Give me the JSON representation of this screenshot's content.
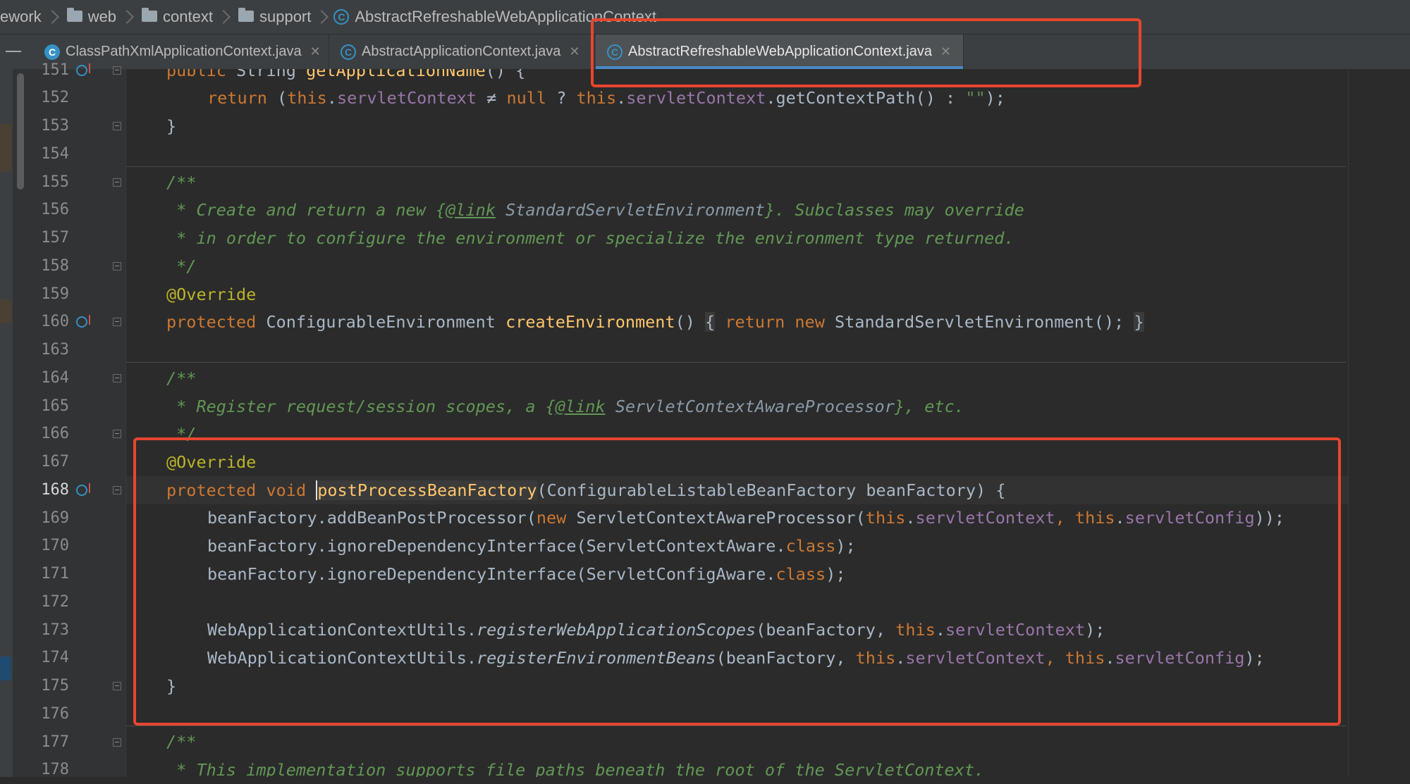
{
  "breadcrumb": {
    "items": [
      "ework",
      "web",
      "context",
      "support"
    ],
    "current": "AbstractRefreshableWebApplicationContext"
  },
  "tabs": [
    {
      "label": "ClassPathXmlApplicationContext.java",
      "icon": "class-icon"
    },
    {
      "label": "AbstractApplicationContext.java",
      "icon": "abstract-class-icon"
    },
    {
      "label": "AbstractRefreshableWebApplicationContext.java",
      "icon": "abstract-class-icon",
      "active": true
    }
  ],
  "editor": {
    "line_numbers": [
      "151",
      "152",
      "153",
      "154",
      "155",
      "156",
      "157",
      "158",
      "159",
      "160",
      "163",
      "164",
      "165",
      "166",
      "167",
      "168",
      "169",
      "170",
      "171",
      "172",
      "173",
      "174",
      "175",
      "176",
      "177",
      "178"
    ],
    "current_line": "168"
  },
  "colors": {
    "background": "#2b2b2b",
    "keyword": "#cc7832",
    "field": "#9876aa",
    "method": "#ffc66d",
    "annotation": "#bbb529",
    "comment": "#629755",
    "annotation_box": "#e8452f"
  },
  "code": {
    "l151": {
      "kw": "public",
      "type": " String ",
      "fn": "getApplicationName",
      "rest": "() {"
    },
    "l152": {
      "kw1": "return",
      "p1": " (",
      "kw2": "this",
      "dot1": ".",
      "f1": "servletContext",
      "p2": " ≠ ",
      "kw3": "null",
      "p3": " ? ",
      "kw4": "this",
      "dot2": ".",
      "f2": "servletContext",
      "p4": ".getContextPath() : ",
      "s": "\"\"",
      "p5": ");"
    },
    "l153": "}",
    "l155": "/**",
    "l156": {
      "a": " * Create and return a new {",
      "tag": "@link",
      "b": " ",
      "ref": "StandardServletEnvironment",
      "c": "}. Subclasses may override"
    },
    "l157": " * in order to configure the environment or specialize the environment type returned.",
    "l158": " */",
    "l159": "@Override",
    "l160": {
      "kw": "protected",
      "type": " ConfigurableEnvironment ",
      "fn": "createEnvironment",
      "p": "() ",
      "fb1": "{",
      "sp": " ",
      "kw2": "return",
      "sp2": " ",
      "kw3": "new",
      "rest": " StandardServletEnvironment();",
      "sp3": " ",
      "fb2": "}"
    },
    "l164": "/**",
    "l165": {
      "a": " * Register request/session scopes, a {",
      "tag": "@link",
      "b": " ",
      "ref": "ServletContextAwareProcessor",
      "c": "}, etc."
    },
    "l166": " */",
    "l167": "@Override",
    "l168": {
      "kw1": "protected",
      "sp": " ",
      "kw2": "void",
      "sp2": " ",
      "fn": "postProcessBeanFactory",
      "rest": "(ConfigurableListableBeanFactory beanFactory) {"
    },
    "l169": {
      "a": "beanFactory.addBeanPostProcessor(",
      "kw": "new",
      "b": " ServletContextAwareProcessor(",
      "kw2": "this",
      "d1": ".",
      "f1": "servletContext",
      "c": ", ",
      "kw3": "this",
      "d2": ".",
      "f2": "servletConfig",
      "e": "));"
    },
    "l170": {
      "a": "beanFactory.ignoreDependencyInterface(ServletContextAware.",
      "kw": "class",
      "b": ");"
    },
    "l171": {
      "a": "beanFactory.ignoreDependencyInterface(ServletConfigAware.",
      "kw": "class",
      "b": ");"
    },
    "l173": {
      "a": "WebApplicationContextUtils.",
      "it": "registerWebApplicationScopes",
      "b": "(beanFactory, ",
      "kw": "this",
      "d": ".",
      "f": "servletContext",
      "c": ");"
    },
    "l174": {
      "a": "WebApplicationContextUtils.",
      "it": "registerEnvironmentBeans",
      "b": "(beanFactory, ",
      "kw": "this",
      "d1": ".",
      "f1": "servletContext",
      "c": ", ",
      "kw2": "this",
      "d2": ".",
      "f2": "servletConfig",
      "e": ");"
    },
    "l175": "}",
    "l177": "/**",
    "l178": " * This implementation supports file paths beneath the root of the ServletContext."
  }
}
